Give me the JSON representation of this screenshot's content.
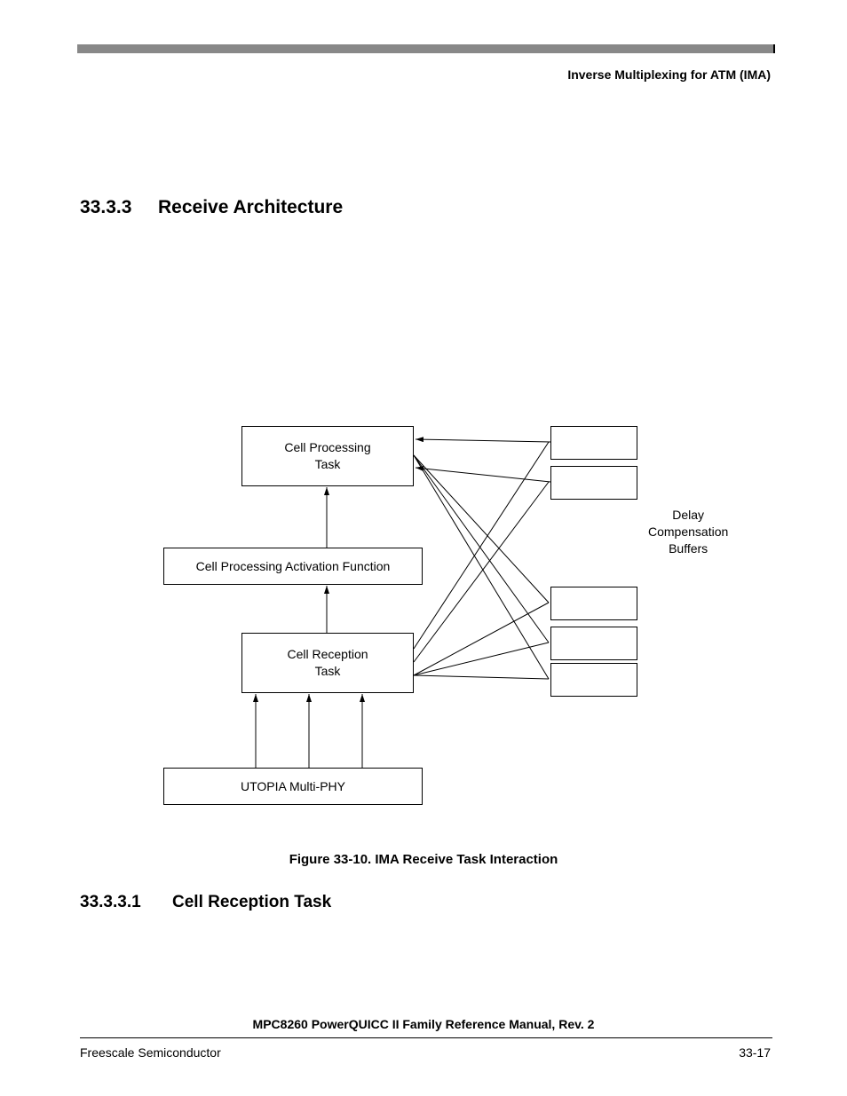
{
  "header": {
    "chapter_title": "Inverse Multiplexing for ATM (IMA)"
  },
  "section": {
    "number": "33.3.3",
    "title": "Receive Architecture"
  },
  "diagram": {
    "box_cell_processing": "Cell Processing\nTask",
    "box_activation": "Cell Processing Activation Function",
    "box_cell_reception": "Cell Reception\nTask",
    "box_utopia": "UTOPIA Multi-PHY",
    "buffers_label": "Delay\nCompensation\nBuffers"
  },
  "figure_caption": "Figure 33-10. IMA Receive Task Interaction",
  "subsection": {
    "number": "33.3.3.1",
    "title": "Cell Reception Task"
  },
  "footer": {
    "manual_title": "MPC8260 PowerQUICC II Family Reference Manual, Rev. 2",
    "left": "Freescale Semiconductor",
    "right": "33-17"
  }
}
